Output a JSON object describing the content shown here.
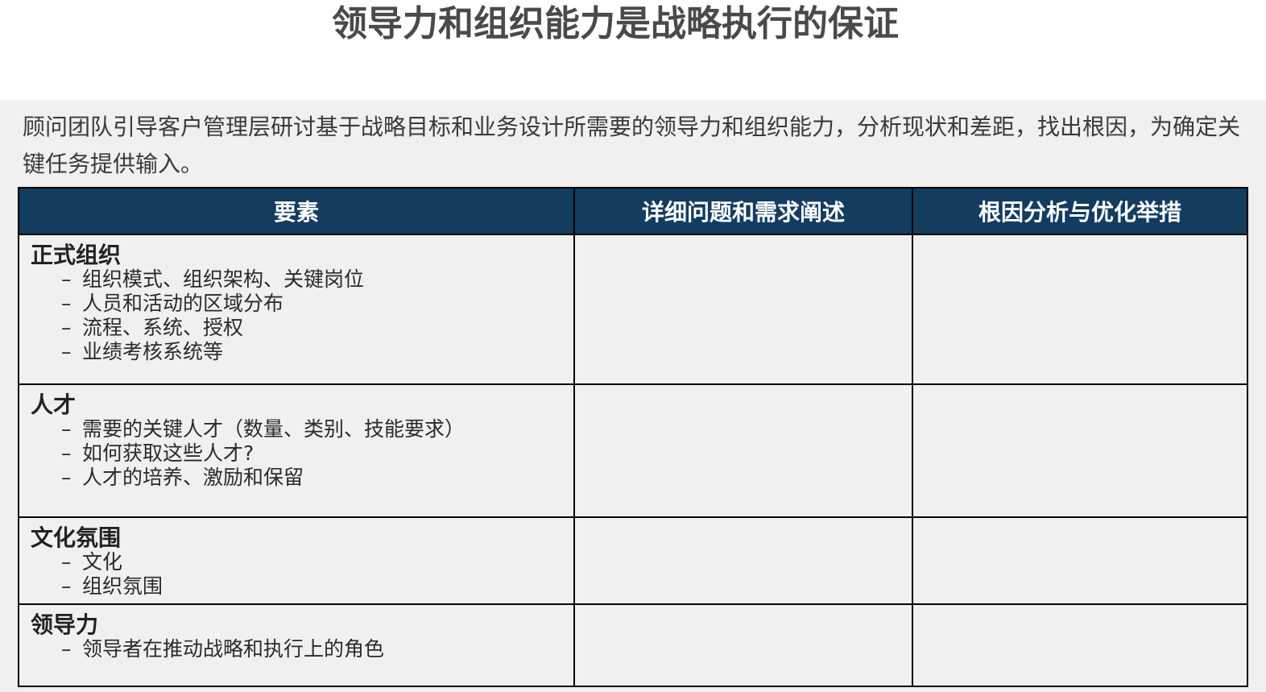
{
  "title": "领导力和组织能力是战略执行的保证",
  "intro": "顾问团队引导客户管理层研讨基于战略目标和业务设计所需要的领导力和组织能力，分析现状和差距，找出根因，为确定关键任务提供输入。",
  "table": {
    "headers": [
      "要素",
      "详细问题和需求阐述",
      "根因分析与优化举措"
    ],
    "rows": [
      {
        "title": "正式组织",
        "bullets": [
          "组织模式、组织架构、关键岗位",
          "人员和活动的区域分布",
          "流程、系统、授权",
          "业绩考核系统等"
        ]
      },
      {
        "title": "人才",
        "bullets": [
          "需要的关键人才（数量、类别、技能要求）",
          "如何获取这些人才?",
          "人才的培养、激励和保留"
        ]
      },
      {
        "title": "文化氛围",
        "bullets": [
          "文化",
          "组织氛围"
        ]
      },
      {
        "title": "领导力",
        "bullets": [
          "领导者在推动战略和执行上的角色"
        ]
      }
    ]
  },
  "bullet_marker": "–"
}
